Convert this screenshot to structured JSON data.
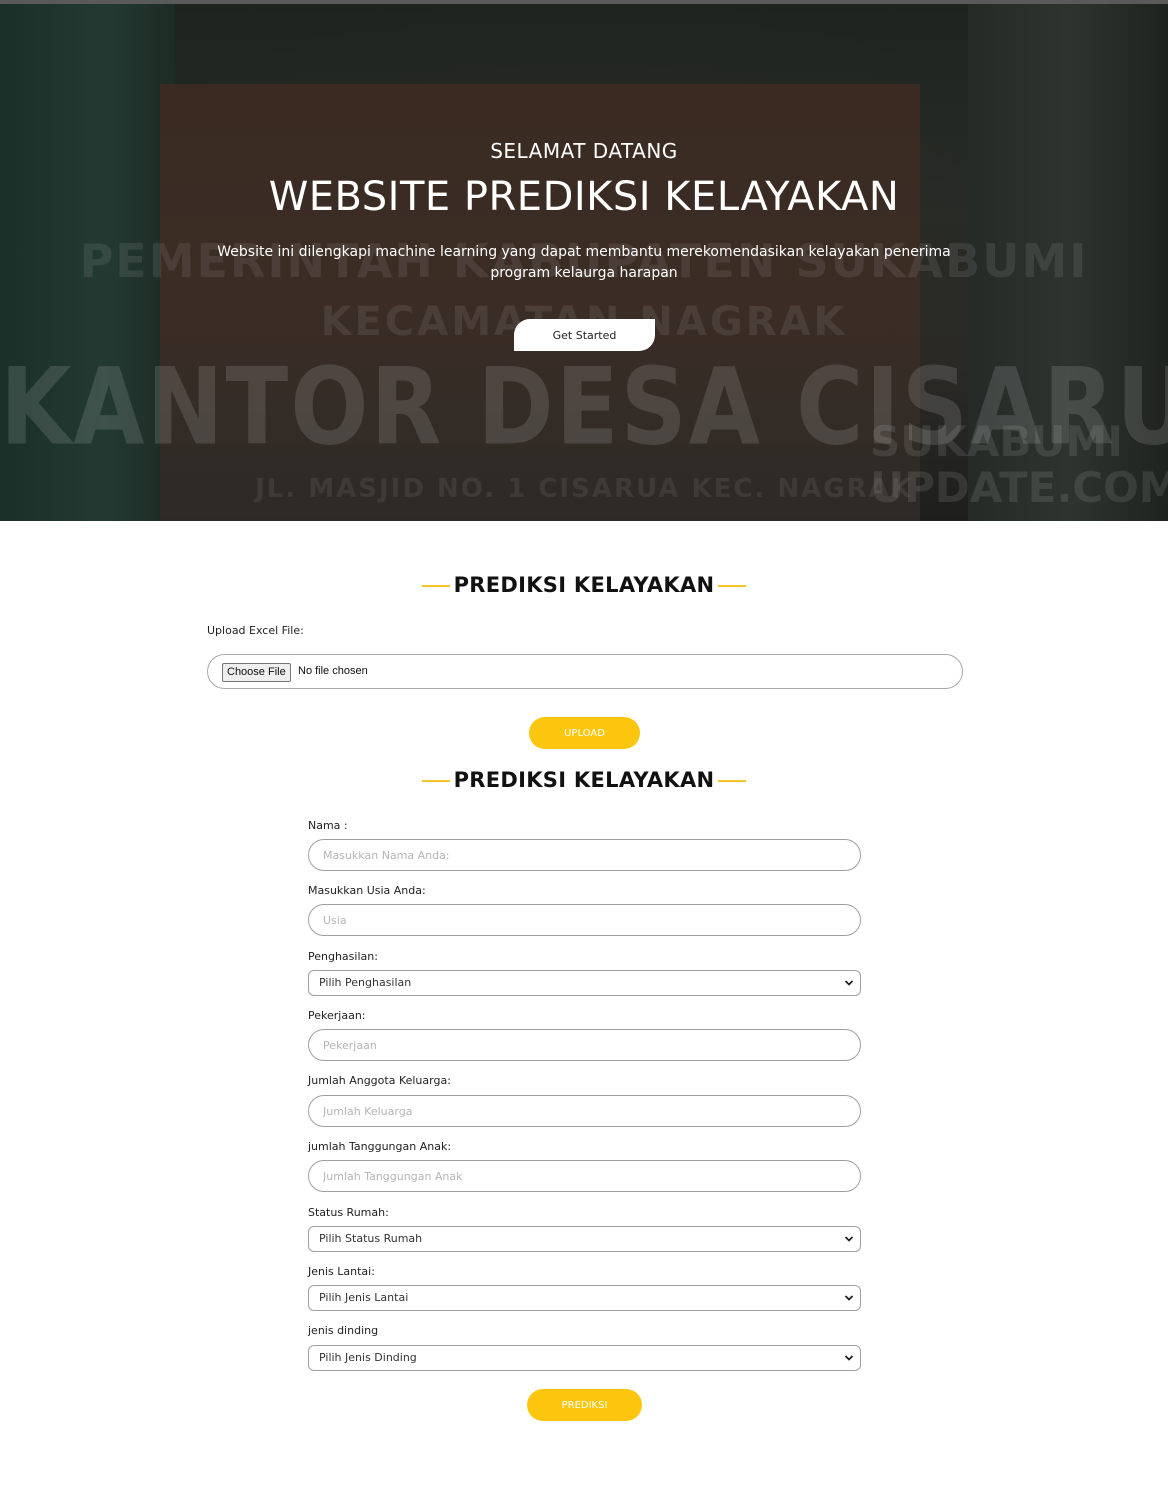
{
  "hero": {
    "wall_lines": [
      "PEMERINTAH KABUPATEN SUKABUMI",
      "KECAMATAN NAGRAK",
      "KANTOR DESA CISARUA",
      "JL. MASJID NO. 1 CISARUA KEC. NAGRAK"
    ],
    "watermark": [
      "SUKABUMI",
      "UPDATE.COM"
    ],
    "welcome": "SELAMAT DATANG",
    "title": "WEBSITE PREDIKSI KELAYAKAN",
    "description": "Website ini dilengkapi machine learning yang dapat membantu merekomendasikan kelayakan penerima program kelaurga harapan",
    "cta_label": "Get Started"
  },
  "upload_section": {
    "title": "PREDIKSI KELAYAKAN",
    "file_label": "Upload Excel File:",
    "choose_file_label": "Choose File",
    "no_file_text": "No file chosen",
    "upload_button": "UPLOAD"
  },
  "form_section": {
    "title": "PREDIKSI KELAYAKAN",
    "fields": {
      "nama": {
        "label": "Nama :",
        "placeholder": "Masukkan Nama Anda:"
      },
      "usia": {
        "label": "Masukkan Usia Anda:",
        "placeholder": "Usia"
      },
      "penghasilan": {
        "label": "Penghasilan:",
        "selected": "Pilih Penghasilan"
      },
      "pekerjaan": {
        "label": "Pekerjaan:",
        "placeholder": "Pekerjaan"
      },
      "jumlah_keluarga": {
        "label": "Jumlah Anggota Keluarga:",
        "placeholder": "Jumlah Keluarga"
      },
      "tanggungan_anak": {
        "label": "jumlah Tanggungan Anak:",
        "placeholder": "Jumlah Tanggungan Anak"
      },
      "status_rumah": {
        "label": "Status Rumah:",
        "selected": "Pilih Status Rumah"
      },
      "jenis_lantai": {
        "label": "Jenis Lantai:",
        "selected": "Pilih Jenis Lantai"
      },
      "jenis_dinding": {
        "label": "jenis dinding",
        "selected": "Pilih Jenis Dinding"
      }
    },
    "submit_button": "PREDIKSI"
  },
  "colors": {
    "accent": "#fdc60e",
    "title_line": "#f6c425",
    "hero_overlay": "#1e2420"
  },
  "icons": {
    "select_arrow": "chevron-down-icon"
  }
}
